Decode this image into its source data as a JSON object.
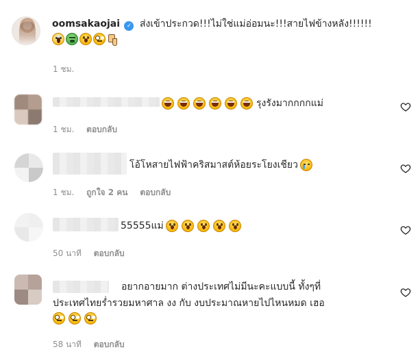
{
  "post": {
    "username": "oomsakaojai",
    "caption": "ส่งเข้าประกวด!!!ไม่ใช่แม่อ่อมนะ!!!สายไฟข้างหลัง!!!!!!",
    "caption_emojis": [
      "scream-emoji",
      "sick-emoji",
      "hushed-emoji",
      "eye-roll-emoji",
      "thumbs-down-emoji"
    ],
    "time": "1 ชม."
  },
  "comments": [
    {
      "text_after_emojis": "รุงรังมากกกกแม่",
      "emojis": [
        "laugh-emoji",
        "laugh-emoji",
        "laugh-emoji",
        "laugh-emoji",
        "laugh-emoji",
        "laugh-emoji"
      ],
      "time": "1 ชม.",
      "reply_label": "ตอบกลับ"
    },
    {
      "text": "โอ้โหสายไฟฟ้าคริสมาสต์ห้อยระโยงเชียว",
      "emojis_after": [
        "cry-emoji"
      ],
      "time": "1 ชม.",
      "likes": "ถูกใจ 2 คน",
      "reply_label": "ตอบกลับ"
    },
    {
      "text": "55555แม่",
      "emojis_after": [
        "hushed-emoji",
        "hushed-emoji",
        "hushed-emoji",
        "hushed-emoji",
        "hushed-emoji"
      ],
      "time": "50 นาที",
      "reply_label": "ตอบกลับ"
    },
    {
      "line1": "อยากอายมาก ต่างประเทศไม่มีนะคะแบบนี้ ทั้งๆที่",
      "line2": "ประเทศไทยร่ำรวยมหาศาล งง กับ งบประมาณหายไปไหนหมด เฮอ",
      "emojis_line3": [
        "eye-roll-emoji",
        "eye-roll-emoji",
        "eye-roll-emoji"
      ],
      "time": "58 นาที",
      "reply_label": "ตอบกลับ"
    }
  ],
  "colors": {
    "text": "#262626",
    "secondary": "#8e8e8e",
    "verified": "#3897f0"
  }
}
